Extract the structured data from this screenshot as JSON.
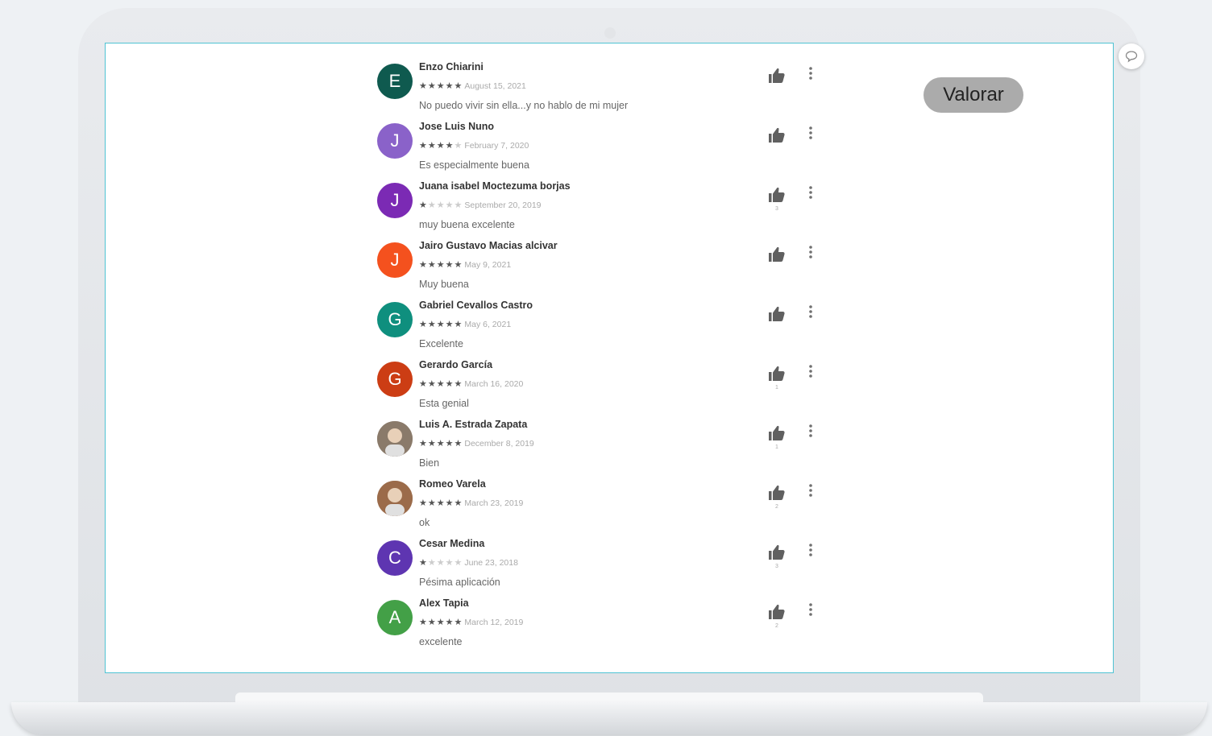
{
  "actions": {
    "valorar_label": "Valorar"
  },
  "reviews": [
    {
      "initial": "E",
      "color": "#0f5a4f",
      "author": "Enzo Chiarini",
      "rating": 5,
      "date": "August 15, 2021",
      "comment": "No puedo vivir sin ella...y no hablo de mi mujer",
      "likes": ""
    },
    {
      "initial": "J",
      "color": "#8a62c9",
      "author": "Jose Luis Nuno",
      "rating": 4,
      "date": "February 7, 2020",
      "comment": "Es especialmente buena",
      "likes": ""
    },
    {
      "initial": "J",
      "color": "#7b2ab4",
      "author": "Juana isabel Moctezuma borjas",
      "rating": 1,
      "date": "September 20, 2019",
      "comment": "muy buena excelente",
      "likes": "3"
    },
    {
      "initial": "J",
      "color": "#f4511e",
      "author": "Jairo Gustavo Macias alcivar",
      "rating": 5,
      "date": "May 9, 2021",
      "comment": "Muy buena",
      "likes": ""
    },
    {
      "initial": "G",
      "color": "#0f8f7e",
      "author": "Gabriel Cevallos Castro",
      "rating": 5,
      "date": "May 6, 2021",
      "comment": "Excelente",
      "likes": ""
    },
    {
      "initial": "G",
      "color": "#cc3d14",
      "author": "Gerardo García",
      "rating": 5,
      "date": "March 16, 2020",
      "comment": "Esta genial",
      "likes": "1"
    },
    {
      "initial": "",
      "color": "#8a7a6a",
      "author": "Luis A. Estrada Zapata",
      "rating": 5,
      "date": "December 8, 2019",
      "comment": "Bien",
      "likes": "1"
    },
    {
      "initial": "",
      "color": "#9b6b4a",
      "author": "Romeo Varela",
      "rating": 5,
      "date": "March 23, 2019",
      "comment": "ok",
      "likes": "2"
    },
    {
      "initial": "C",
      "color": "#5e35b1",
      "author": "Cesar Medina",
      "rating": 1,
      "date": "June 23, 2018",
      "comment": "Pésima aplicación",
      "likes": "3"
    },
    {
      "initial": "A",
      "color": "#43a047",
      "author": "Alex Tapia",
      "rating": 5,
      "date": "March 12, 2019",
      "comment": "excelente",
      "likes": "2"
    }
  ]
}
